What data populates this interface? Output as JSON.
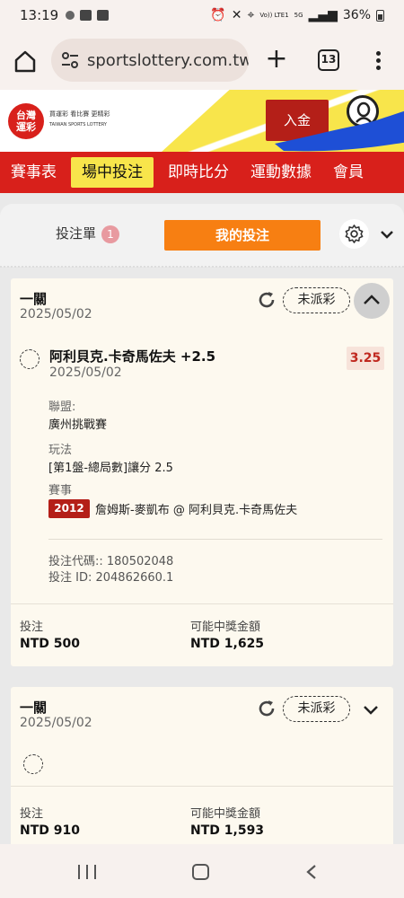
{
  "status_bar": {
    "time": "13:19",
    "network": "Vo)) LTE1",
    "signal": "5G",
    "battery": "36%"
  },
  "browser": {
    "url": "sportslottery.com.tw",
    "tab_count": "13"
  },
  "site": {
    "logo_text": "台灣\n運彩",
    "logo_tagline": "買運彩 看比賽 更精彩",
    "logo_english": "TAIWAN SPORTS LOTTERY",
    "deposit_label": "入金"
  },
  "nav": {
    "items": [
      "賽事表",
      "場中投注",
      "即時比分",
      "運動數據",
      "會員"
    ],
    "active_index": 1
  },
  "bet_panel": {
    "betslip_label": "投注單",
    "betslip_count": "1",
    "my_bets_label": "我的投注"
  },
  "bets": [
    {
      "title": "一關",
      "date": "2025/05/02",
      "status": "未派彩",
      "expanded": true,
      "selection": {
        "title": "阿利貝克.卡奇馬佐夫 +2.5",
        "date": "2025/05/02",
        "odds": "3.25",
        "league_label": "聯盟:",
        "league": "廣州挑戰賽",
        "market_label": "玩法",
        "market": "[第1盤-總局數]讓分 2.5",
        "event_label": "賽事",
        "event_code": "2012",
        "event": "詹姆斯-麥凱布 @ 阿利貝克.卡奇馬佐夫"
      },
      "bet_code": "投注代碼:: 180502048",
      "bet_id": "投注 ID: 204862660.1",
      "stake_label": "投注",
      "stake": "NTD 500",
      "payout_label": "可能中獎金額",
      "payout": "NTD 1,625"
    },
    {
      "title": "一關",
      "date": "2025/05/02",
      "status": "未派彩",
      "expanded": false,
      "stake_label": "投注",
      "stake": "NTD 910",
      "payout_label": "可能中獎金額",
      "payout": "NTD 1,593"
    }
  ],
  "colors": {
    "brand_red": "#d8201b",
    "accent_yellow": "#f8e54b",
    "orange": "#f77f12",
    "card_bg": "#fdf9ef"
  }
}
